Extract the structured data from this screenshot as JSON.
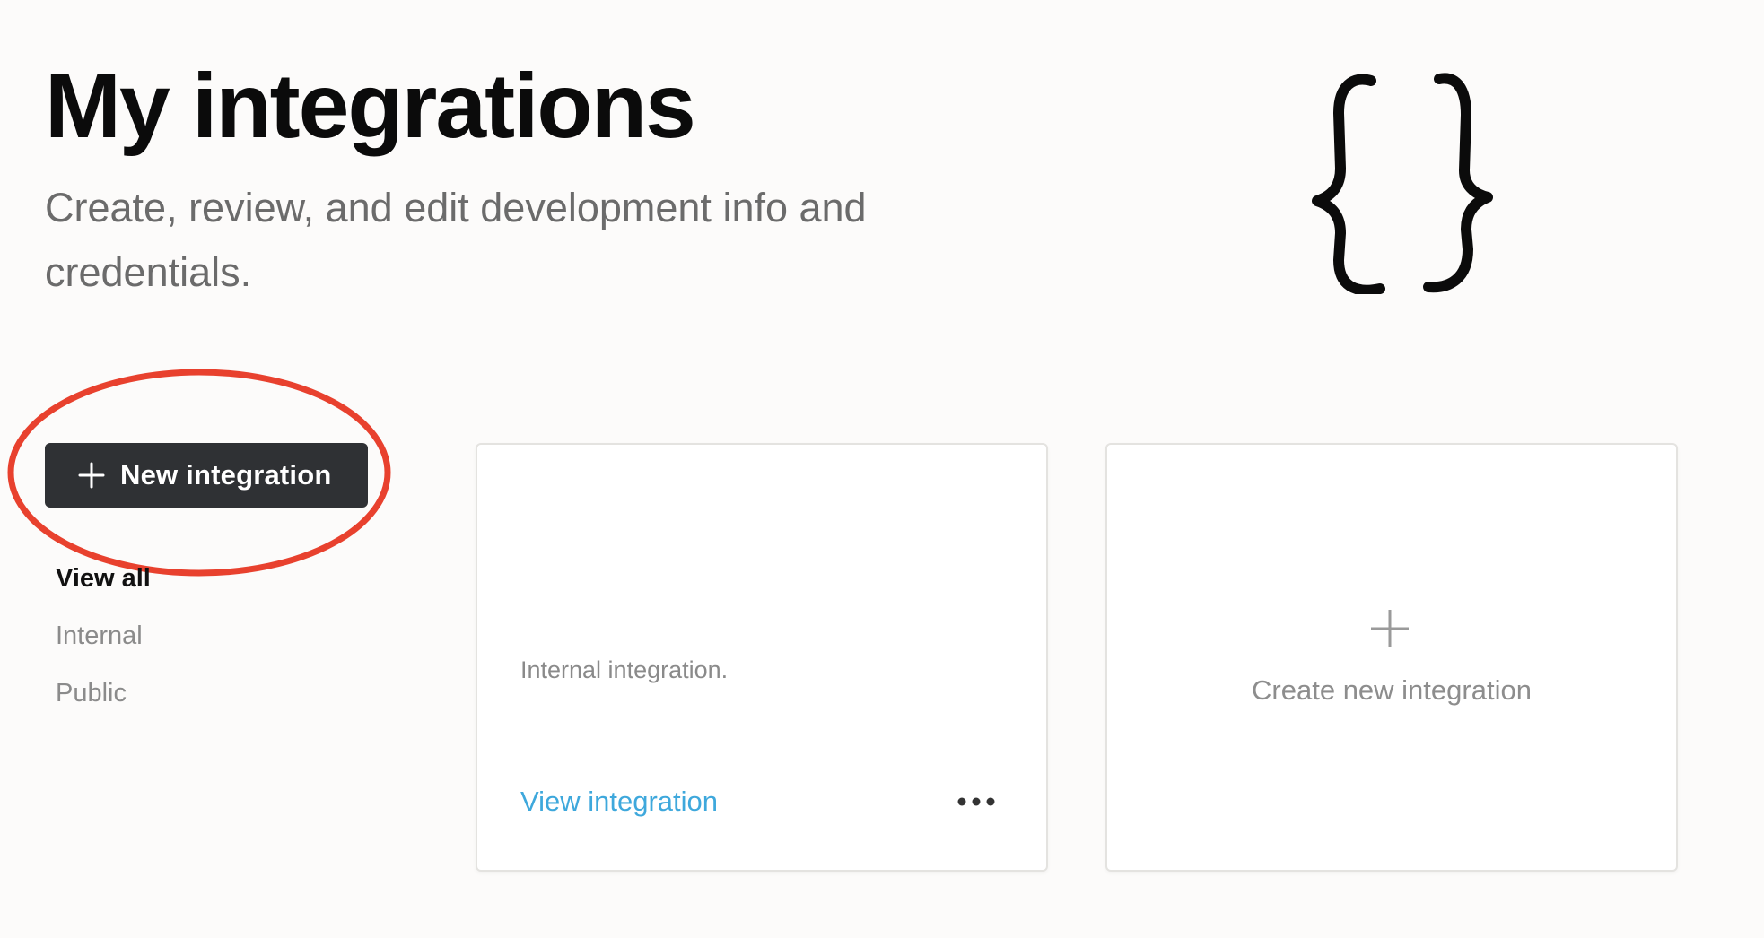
{
  "header": {
    "title": "My integrations",
    "subtitle": "Create, review, and edit development info and credentials."
  },
  "hero_icon": "curly-braces-icon",
  "annotation": {
    "shape": "ellipse",
    "color": "#e8412e",
    "target": "new-integration-button"
  },
  "actions": {
    "new_integration_label": "New integration",
    "new_integration_icon": "plus-icon"
  },
  "filters": {
    "items": [
      {
        "label": "View all",
        "active": true
      },
      {
        "label": "Internal",
        "active": false
      },
      {
        "label": "Public",
        "active": false
      }
    ]
  },
  "cards": {
    "integration": {
      "description": "Internal integration.",
      "link_label": "View integration",
      "more_icon": "more-horizontal-icon"
    },
    "create": {
      "label": "Create new integration",
      "icon": "plus-icon"
    }
  },
  "colors": {
    "background": "#fcfbfa",
    "button": "#2f3134",
    "link": "#3ea8dc",
    "annotation": "#e8412e"
  }
}
